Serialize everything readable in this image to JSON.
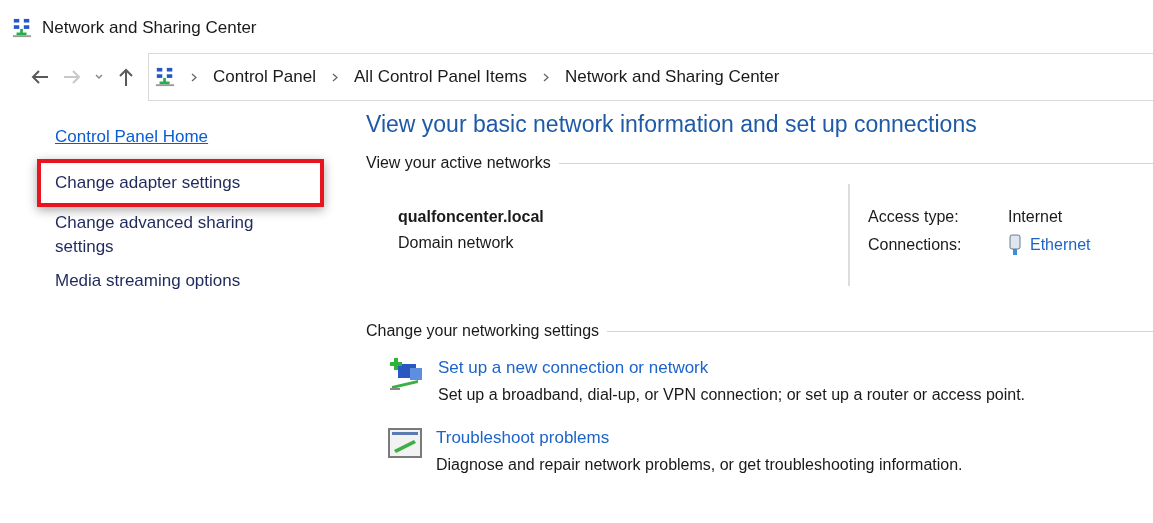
{
  "window": {
    "title": "Network and Sharing Center"
  },
  "navigation": {
    "back_disabled": false,
    "forward_disabled": true,
    "breadcrumbs": [
      "Control Panel",
      "All Control Panel Items",
      "Network and Sharing Center"
    ]
  },
  "sidebar": {
    "items": [
      {
        "label": "Control Panel Home",
        "kind": "home",
        "highlighted": false
      },
      {
        "label": "Change adapter settings",
        "kind": "task",
        "highlighted": true
      },
      {
        "label": "Change advanced sharing settings",
        "kind": "task",
        "highlighted": false
      },
      {
        "label": "Media streaming options",
        "kind": "task",
        "highlighted": false
      }
    ]
  },
  "main": {
    "heading": "View your basic network information and set up connections",
    "active_networks": {
      "title": "View your active networks",
      "network_name": "qualfoncenter.local",
      "network_type": "Domain network",
      "access_type_label": "Access type:",
      "access_type": "Internet",
      "connections_label": "Connections:",
      "connection": "Ethernet"
    },
    "settings": {
      "title": "Change your networking settings",
      "tasks": [
        {
          "kind": "new-connection",
          "title": "Set up a new connection or network",
          "description": "Set up a broadband, dial-up, or VPN connection; or set up a router or access point."
        },
        {
          "kind": "troubleshoot",
          "title": "Troubleshoot problems",
          "description": "Diagnose and repair network problems, or get troubleshooting information."
        }
      ]
    }
  }
}
